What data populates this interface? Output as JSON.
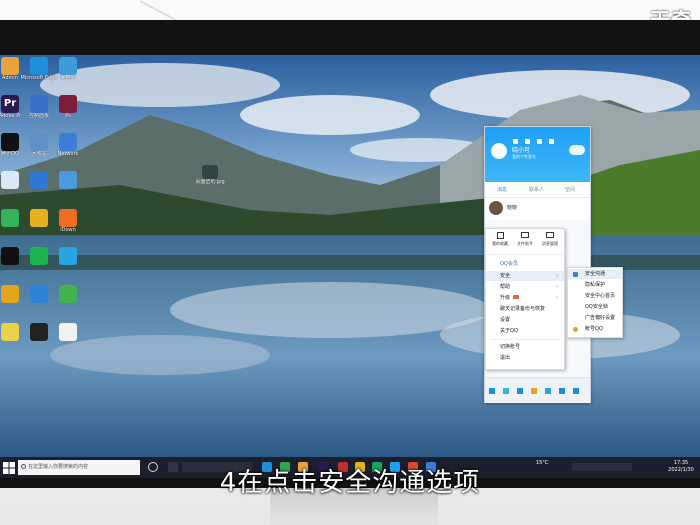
{
  "watermark": "天奇",
  "subtitle": "4在点击安全沟通选项",
  "desktop_icons": [
    {
      "label": "Admin",
      "color": "#e8a23c",
      "glyph": ""
    },
    {
      "label": "Microsoft Edge",
      "color": "#1e8fd8",
      "glyph": ""
    },
    {
      "label": "此电脑",
      "color": "#3d9bd9",
      "glyph": ""
    },
    {
      "label": "Adobe Pr",
      "color": "#2b1a52",
      "glyph": "Pr"
    },
    {
      "label": "Ps",
      "color": "#7a1c3a",
      "glyph": ""
    },
    {
      "label": "控制面板",
      "color": "#3b6fc9",
      "glyph": ""
    },
    {
      "label": "腾讯QQ",
      "color": "#111",
      "glyph": ""
    },
    {
      "label": "回收站",
      "color": "#5e8fc7",
      "glyph": ""
    },
    {
      "label": "Network",
      "color": "#3b7fd6",
      "glyph": ""
    },
    {
      "label": "",
      "color": "#dbe8f5",
      "glyph": ""
    },
    {
      "label": "",
      "color": "#2c7ad6",
      "glyph": ""
    },
    {
      "label": "",
      "color": "#4b9ae0",
      "glyph": ""
    },
    {
      "label": "",
      "color": "#35b35a",
      "glyph": ""
    },
    {
      "label": "",
      "color": "#e6b021",
      "glyph": ""
    },
    {
      "label": "iDown",
      "color": "#ee6f21",
      "glyph": ""
    },
    {
      "label": "",
      "color": "#111",
      "glyph": ""
    },
    {
      "label": "",
      "color": "#1ab34d",
      "glyph": ""
    },
    {
      "label": "",
      "color": "#29a4e3",
      "glyph": ""
    },
    {
      "label": "",
      "color": "#e2a419",
      "glyph": ""
    },
    {
      "label": "",
      "color": "#2e82d8",
      "glyph": ""
    },
    {
      "label": "",
      "color": "#43b24f",
      "glyph": ""
    },
    {
      "label": "",
      "color": "#e7d24a",
      "glyph": ""
    },
    {
      "label": "",
      "color": "#222",
      "glyph": ""
    },
    {
      "label": "",
      "color": "#f2f2f2",
      "glyph": ""
    }
  ],
  "file_icon_label": "桌面壁纸.jpg",
  "taskbar": {
    "search_placeholder": "在这里输入你要搜索的内容",
    "weather": "15°C",
    "time": "17:35",
    "date": "2022/1/30"
  },
  "qq": {
    "username": "晓小可",
    "status": "我的个性签名",
    "tabs": [
      "消息",
      "联系人",
      "空间"
    ],
    "contact_name": "晓晓",
    "shortcuts": [
      "我的收藏",
      "文件助手",
      "消息管理"
    ],
    "menu_items": [
      "QQ会员",
      "安全",
      "帮助",
      "升级",
      "聊天记录备份与恢复",
      "设置",
      "关于QQ",
      "切换账号",
      "退出"
    ],
    "submenu_items": [
      "安全沟通",
      "隐私保护",
      "安全中心首页",
      "QQ安全锁",
      "广告偏好设置",
      "帐号QQ"
    ]
  }
}
